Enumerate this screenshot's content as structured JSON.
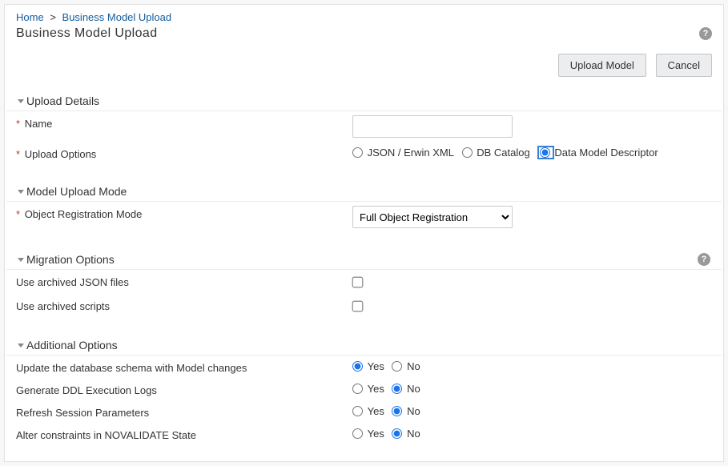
{
  "breadcrumb": {
    "home": "Home",
    "current": "Business Model Upload"
  },
  "page_title": "Business Model Upload",
  "buttons": {
    "upload": "Upload Model",
    "cancel": "Cancel"
  },
  "sections": {
    "upload_details": "Upload Details",
    "model_upload_mode": "Model Upload Mode",
    "migration_options": "Migration Options",
    "additional_options": "Additional Options"
  },
  "fields": {
    "name_label": "Name",
    "name_value": "",
    "upload_options_label": "Upload Options",
    "upload_options": {
      "json": "JSON / Erwin XML",
      "db": "DB Catalog",
      "dmd": "Data Model Descriptor"
    },
    "object_registration_mode_label": "Object Registration Mode",
    "object_registration_mode_value": "Full Object Registration",
    "use_archived_json_label": "Use archived JSON files",
    "use_archived_scripts_label": "Use archived scripts",
    "update_schema_label": "Update the database schema with Model changes",
    "generate_ddl_label": "Generate DDL Execution Logs",
    "refresh_session_label": "Refresh Session Parameters",
    "alter_constraints_label": "Alter constraints in NOVALIDATE State"
  },
  "yes_no": {
    "yes": "Yes",
    "no": "No"
  }
}
